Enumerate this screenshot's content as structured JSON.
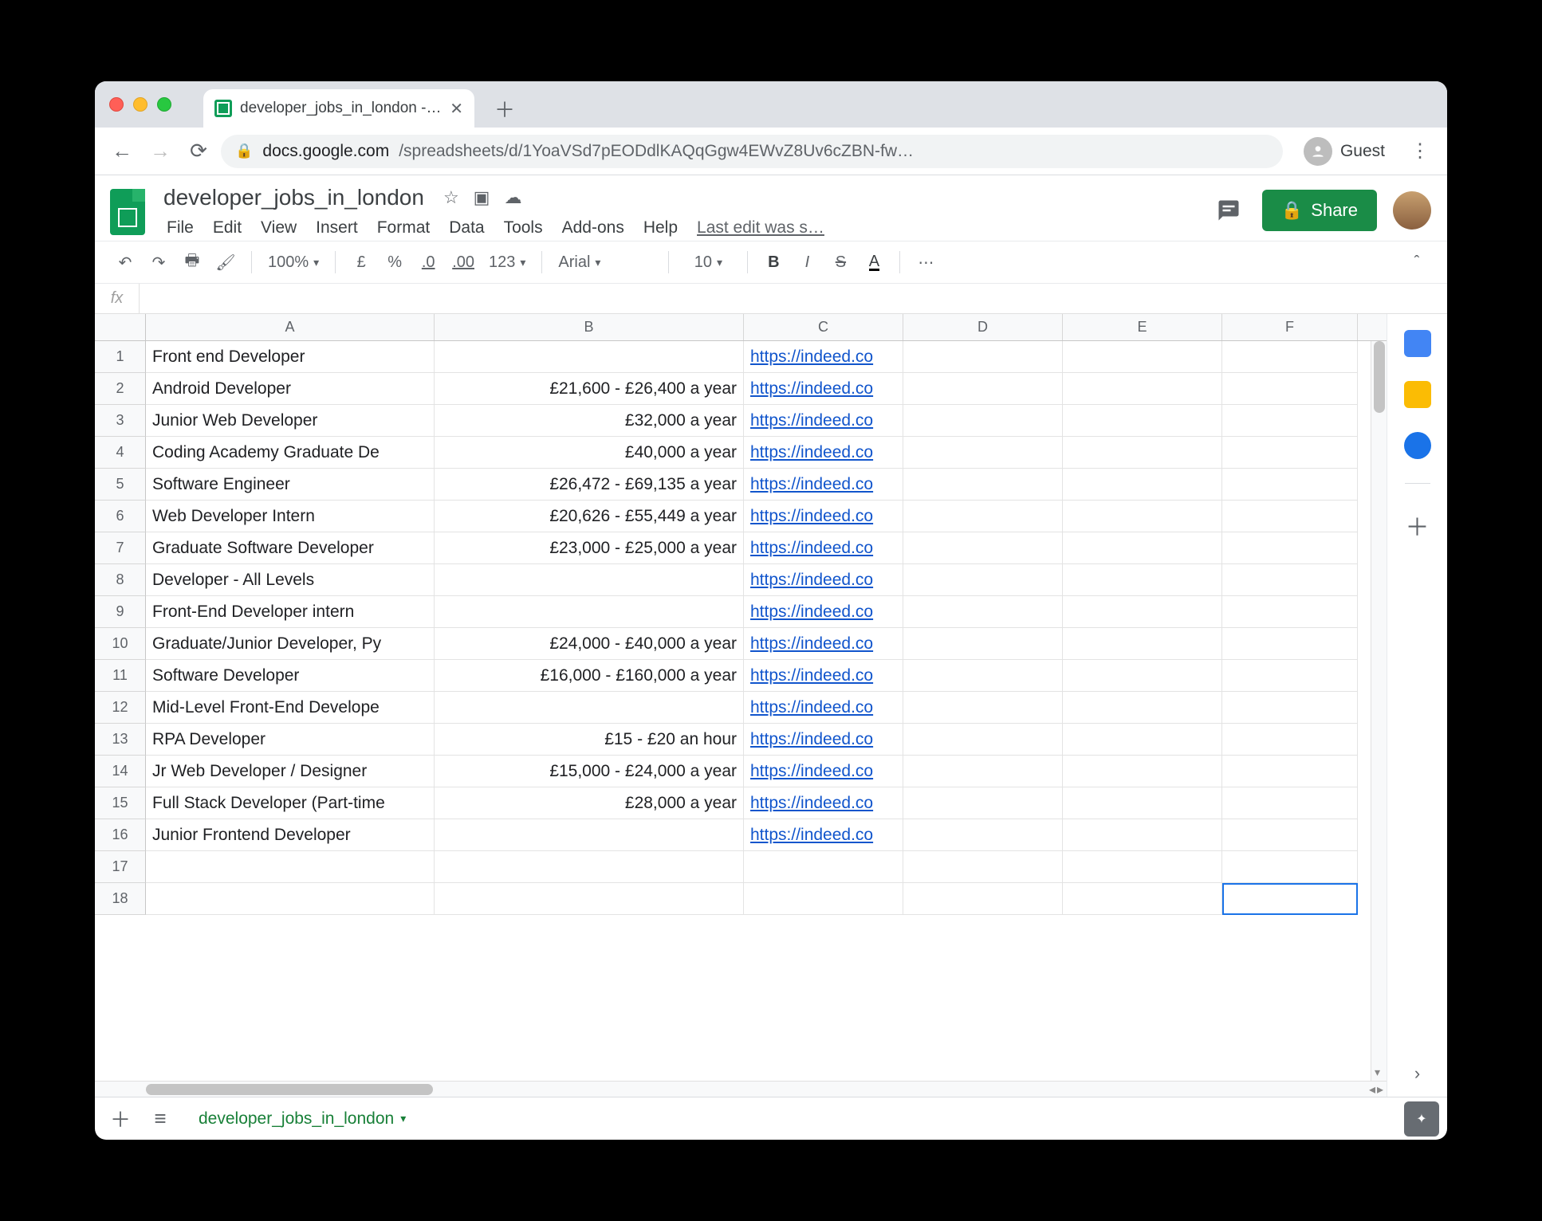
{
  "browser": {
    "tab_title": "developer_jobs_in_london - Go",
    "url_host": "docs.google.com",
    "url_path": "/spreadsheets/d/1YoaVSd7pEODdlKAQqGgw4EWvZ8Uv6cZBN-fw…",
    "guest_label": "Guest"
  },
  "doc": {
    "title": "developer_jobs_in_london",
    "menus": [
      "File",
      "Edit",
      "View",
      "Insert",
      "Format",
      "Data",
      "Tools",
      "Add-ons",
      "Help"
    ],
    "last_edit": "Last edit was s…",
    "share_label": "Share"
  },
  "toolbar": {
    "zoom": "100%",
    "currency": "£",
    "percent": "%",
    "dec_dec": ".0",
    "inc_dec": ".00",
    "more_fmt": "123",
    "font": "Arial",
    "size": "10",
    "bold": "B",
    "italic": "I",
    "strike": "S",
    "textcolor": "A",
    "more": "⋯"
  },
  "columns": [
    "A",
    "B",
    "C",
    "D",
    "E",
    "F"
  ],
  "rows": [
    {
      "n": "1",
      "a": "Front end Developer",
      "b": "",
      "c": "https://indeed.co"
    },
    {
      "n": "2",
      "a": "Android Developer",
      "b": "£21,600 - £26,400 a year",
      "c": "https://indeed.co"
    },
    {
      "n": "3",
      "a": "Junior Web Developer",
      "b": "£32,000 a year",
      "c": "https://indeed.co"
    },
    {
      "n": "4",
      "a": "Coding Academy Graduate De",
      "b": "£40,000 a year",
      "c": "https://indeed.co"
    },
    {
      "n": "5",
      "a": "Software Engineer",
      "b": "£26,472 - £69,135 a year",
      "c": "https://indeed.co"
    },
    {
      "n": "6",
      "a": "Web Developer Intern",
      "b": "£20,626 - £55,449 a year",
      "c": "https://indeed.co"
    },
    {
      "n": "7",
      "a": "Graduate Software Developer",
      "b": "£23,000 - £25,000 a year",
      "c": "https://indeed.co"
    },
    {
      "n": "8",
      "a": "Developer - All Levels",
      "b": "",
      "c": "https://indeed.co"
    },
    {
      "n": "9",
      "a": "Front-End Developer intern",
      "b": "",
      "c": "https://indeed.co"
    },
    {
      "n": "10",
      "a": "Graduate/Junior Developer, Py",
      "b": "£24,000 - £40,000 a year",
      "c": "https://indeed.co"
    },
    {
      "n": "11",
      "a": "Software Developer",
      "b": "£16,000 - £160,000 a year",
      "c": "https://indeed.co"
    },
    {
      "n": "12",
      "a": "Mid-Level Front-End Develope",
      "b": "",
      "c": "https://indeed.co"
    },
    {
      "n": "13",
      "a": "RPA Developer",
      "b": "£15 - £20 an hour",
      "c": "https://indeed.co"
    },
    {
      "n": "14",
      "a": "Jr Web Developer / Designer",
      "b": "£15,000 - £24,000 a year",
      "c": "https://indeed.co"
    },
    {
      "n": "15",
      "a": "Full Stack Developer (Part-time",
      "b": "£28,000 a year",
      "c": "https://indeed.co"
    },
    {
      "n": "16",
      "a": "Junior Frontend Developer",
      "b": "",
      "c": "https://indeed.co"
    },
    {
      "n": "17",
      "a": "",
      "b": "",
      "c": ""
    },
    {
      "n": "18",
      "a": "",
      "b": "",
      "c": ""
    }
  ],
  "sheet_tab": "developer_jobs_in_london"
}
